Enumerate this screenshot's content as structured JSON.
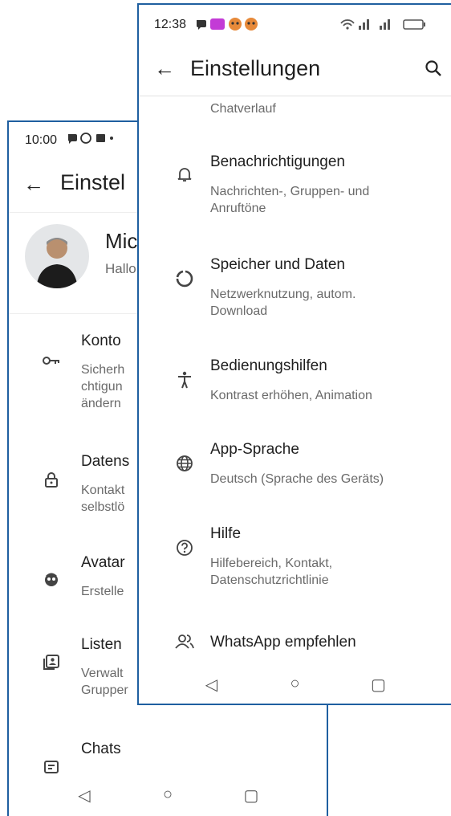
{
  "back_phone": {
    "status": {
      "time": "10:00"
    },
    "appbar": {
      "title": "Einstel"
    },
    "profile": {
      "name": "Mic",
      "status": "Hallo"
    },
    "items": [
      {
        "label": "Konto",
        "sub": "Sicherh\nchtigun\nändern",
        "icon": "key-icon"
      },
      {
        "label": "Datens",
        "sub": "Kontakt\nselbstlö",
        "icon": "lock-icon"
      },
      {
        "label": "Avatar",
        "sub": "Erstelle",
        "icon": "avatar-face-icon"
      },
      {
        "label": "Listen",
        "sub": "Verwalt\nGrupper",
        "icon": "contacts-list-icon"
      },
      {
        "label": "Chats",
        "sub": "",
        "icon": "chat-icon"
      }
    ]
  },
  "front_phone": {
    "status": {
      "time": "12:38"
    },
    "appbar": {
      "title": "Einstellungen"
    },
    "cut_sub": "Chatverlauf",
    "items": [
      {
        "label": "Benachrichtigungen",
        "sub": "Nachrichten-, Gruppen- und\nAnruftöne",
        "icon": "bell-icon"
      },
      {
        "label": "Speicher und Daten",
        "sub": "Netzwerknutzung, autom.\nDownload",
        "icon": "data-usage-icon"
      },
      {
        "label": "Bedienungshilfen",
        "sub": "Kontrast erhöhen, Animation",
        "icon": "accessibility-icon"
      },
      {
        "label": "App-Sprache",
        "sub": "Deutsch (Sprache des Geräts)",
        "icon": "globe-icon"
      },
      {
        "label": "Hilfe",
        "sub": "Hilfebereich, Kontakt,\nDatenschutzrichtlinie",
        "icon": "help-icon"
      },
      {
        "label": "WhatsApp empfehlen",
        "sub": "",
        "icon": "people-icon"
      }
    ]
  },
  "colors": {
    "frame": "#1f5fa0",
    "text": "#1f1f1f",
    "subtext": "#6a6a6a",
    "icon": "#4a4a4a"
  }
}
